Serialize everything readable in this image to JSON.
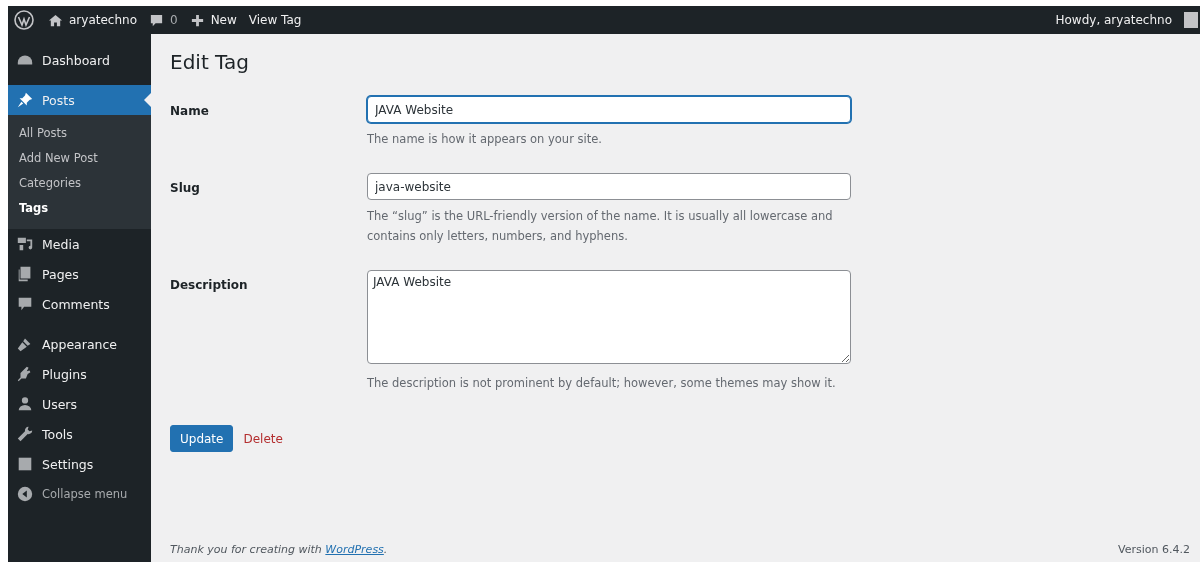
{
  "admin_bar": {
    "site": "aryatechno",
    "comments": "0",
    "new": "New",
    "view": "View Tag",
    "greeting": "Howdy, aryatechno"
  },
  "sidebar": {
    "items": [
      {
        "label": "Dashboard",
        "selected": false
      },
      {
        "label": "Posts",
        "selected": true,
        "children": [
          {
            "label": "All Posts",
            "selected": false
          },
          {
            "label": "Add New Post",
            "selected": false
          },
          {
            "label": "Categories",
            "selected": false
          },
          {
            "label": "Tags",
            "selected": true
          }
        ]
      },
      {
        "label": "Media",
        "selected": false
      },
      {
        "label": "Pages",
        "selected": false
      },
      {
        "label": "Comments",
        "selected": false
      },
      {
        "label": "Appearance",
        "selected": false
      },
      {
        "label": "Plugins",
        "selected": false
      },
      {
        "label": "Users",
        "selected": false
      },
      {
        "label": "Tools",
        "selected": false
      },
      {
        "label": "Settings",
        "selected": false
      }
    ],
    "collapse": "Collapse menu"
  },
  "page_title": "Edit Tag",
  "fields": [
    {
      "kind": "input",
      "label": "Name",
      "value": "JAVA Website",
      "focused": true,
      "help": [
        "The name is how it appears on your site."
      ]
    },
    {
      "kind": "input",
      "label": "Slug",
      "value": "java-website",
      "focused": false,
      "help": [
        "The “slug” is the URL-friendly version of the name. It is usually all lowercase and",
        "contains only letters, numbers, and hyphens."
      ]
    },
    {
      "kind": "textarea",
      "label": "Description",
      "value": "JAVA Website",
      "focused": false,
      "help": [
        "The description is not prominent by default; however, some themes may show it."
      ]
    }
  ],
  "update_button": "Update",
  "delete_link": "Delete",
  "footer": {
    "text": "Thank you for creating with",
    "link": "WordPress",
    "after": ".",
    "version": "Version 6.4.2"
  }
}
